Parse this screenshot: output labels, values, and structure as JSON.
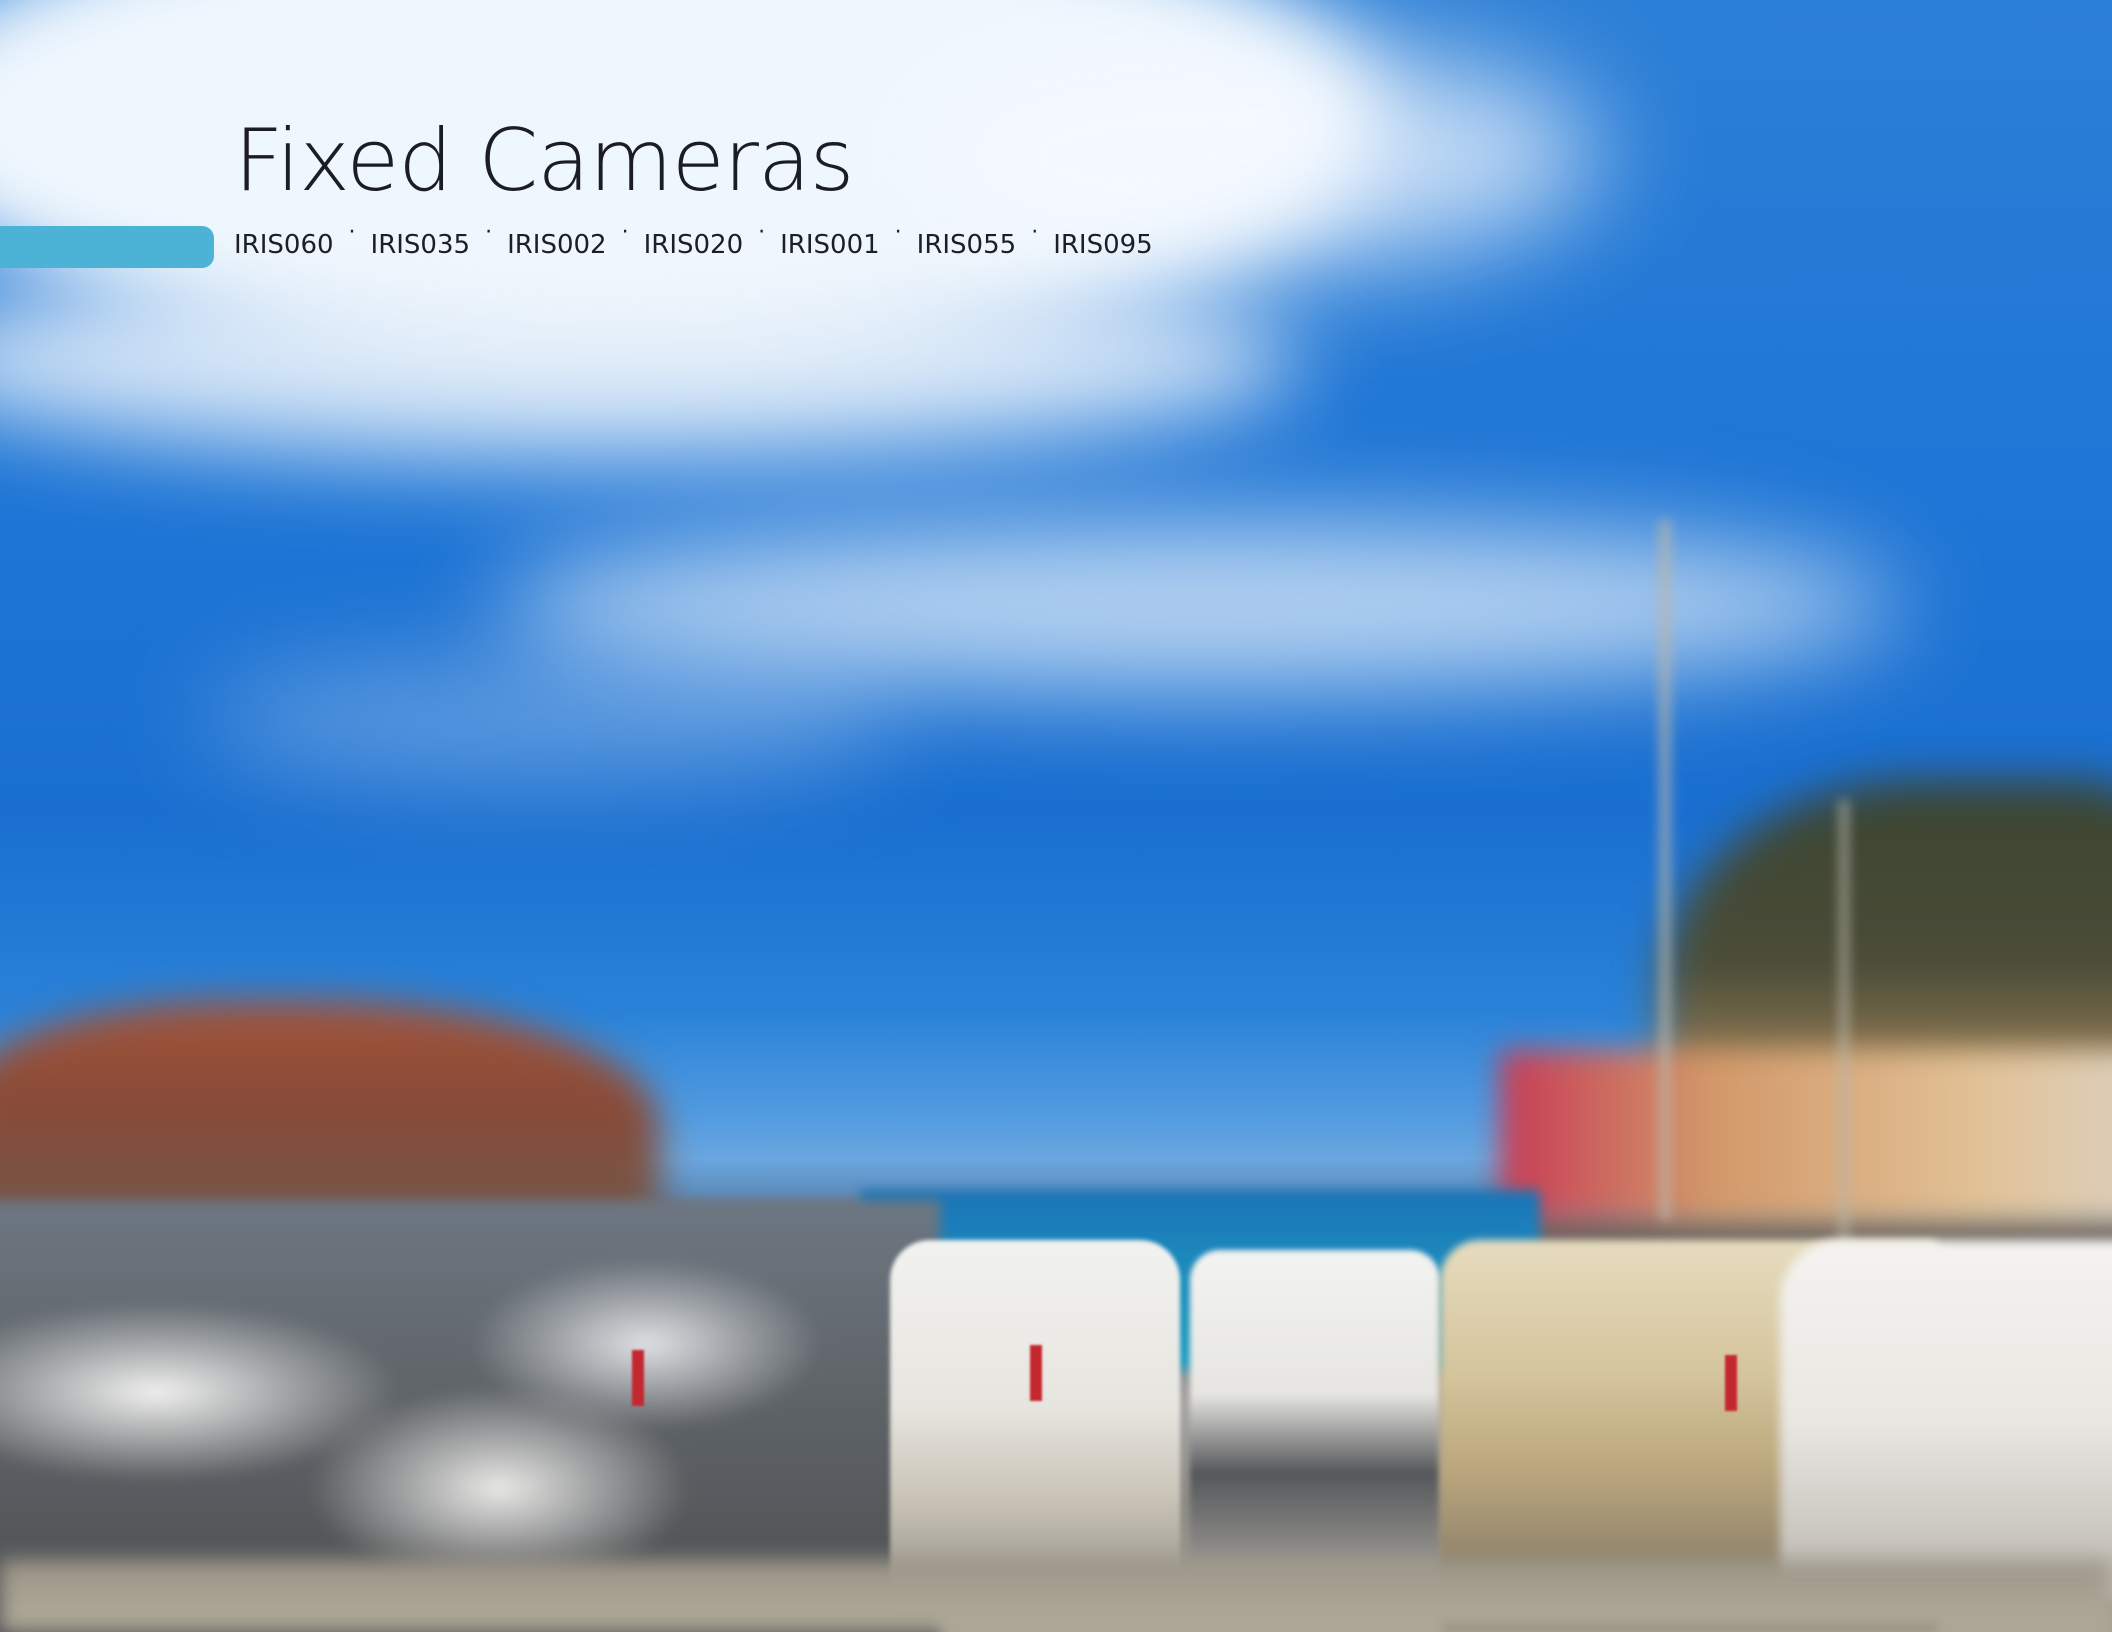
{
  "header": {
    "title": "Fixed Cameras",
    "accent_color": "#4db3d6"
  },
  "models": {
    "separator": "·",
    "items": [
      "IRIS060",
      "IRIS035",
      "IRIS002",
      "IRIS020",
      "IRIS001",
      "IRIS055",
      "IRIS095"
    ]
  }
}
